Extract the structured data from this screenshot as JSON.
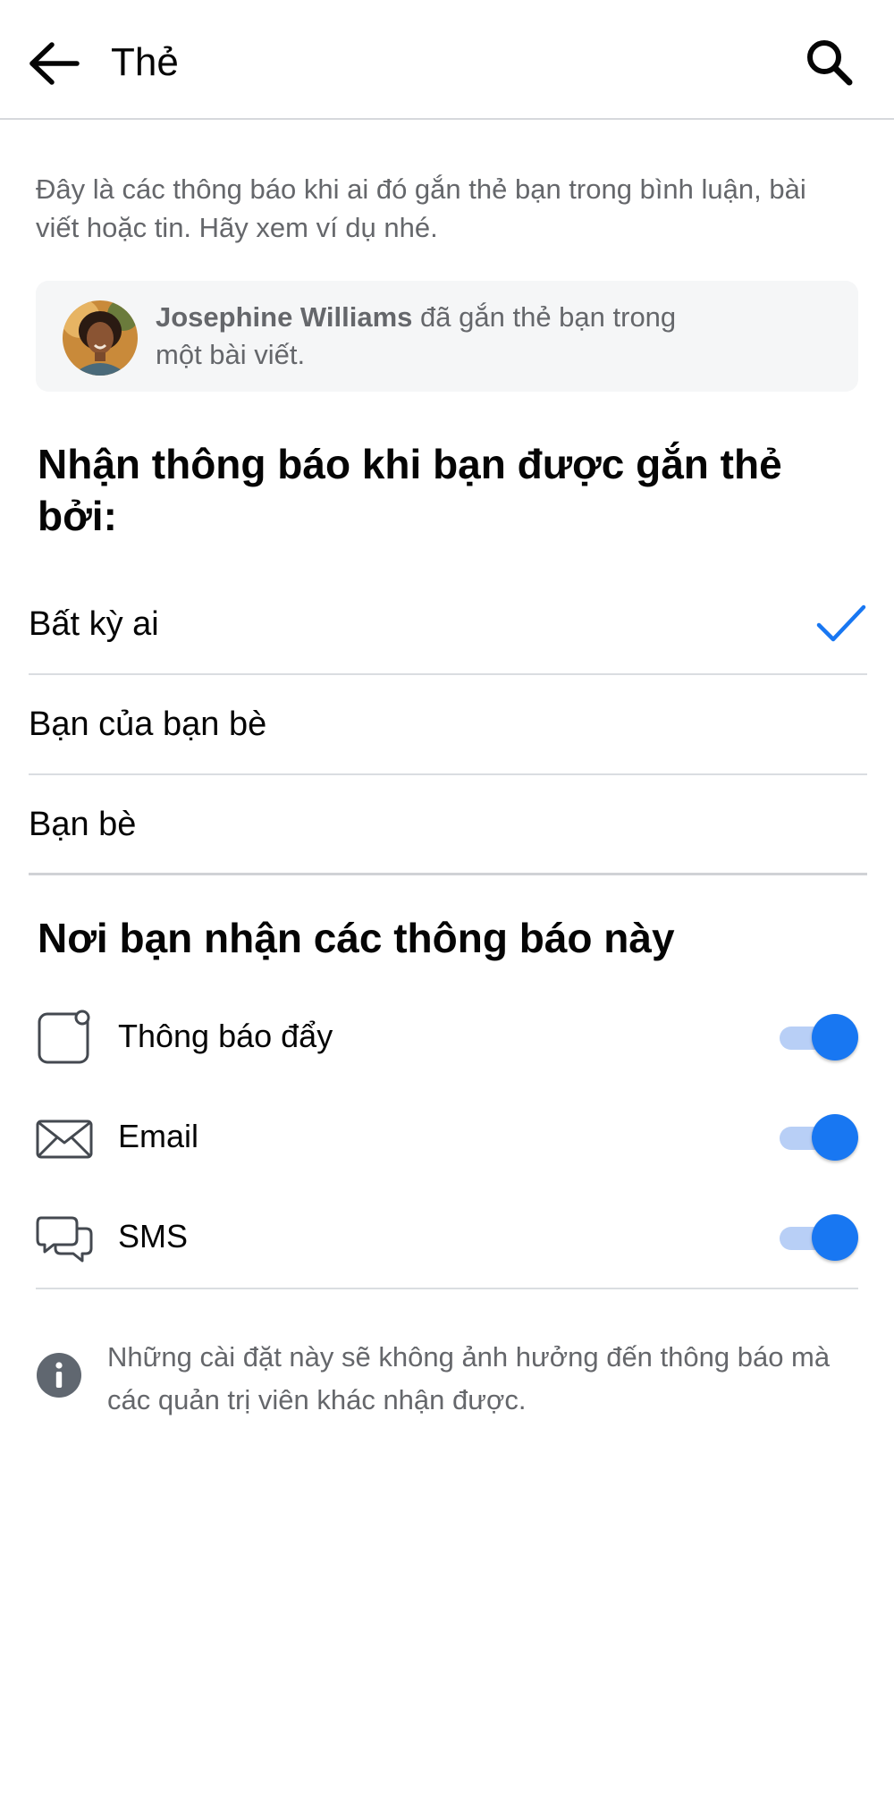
{
  "header": {
    "title": "Thẻ",
    "back_icon": "arrow-left-icon",
    "search_icon": "search-icon"
  },
  "intro": {
    "text": "Đây là các thông báo khi ai đó gắn thẻ bạn trong bình luận, bài viết hoặc tin. Hãy xem ví dụ nhé."
  },
  "example": {
    "name": "Josephine Williams",
    "message": " đã gắn thẻ bạn trong một bài viết."
  },
  "tag_section": {
    "heading": "Nhận thông báo khi bạn được gắn thẻ bởi:",
    "options": [
      {
        "label": "Bất kỳ ai",
        "selected": true
      },
      {
        "label": "Bạn của bạn bè",
        "selected": false
      },
      {
        "label": "Bạn bè",
        "selected": false
      }
    ]
  },
  "channels_section": {
    "heading": "Nơi bạn nhận các thông báo này",
    "channels": [
      {
        "label": "Thông báo đẩy",
        "icon": "push-notification-icon",
        "enabled": true
      },
      {
        "label": "Email",
        "icon": "envelope-icon",
        "enabled": true
      },
      {
        "label": "SMS",
        "icon": "chat-bubbles-icon",
        "enabled": true
      }
    ]
  },
  "footer": {
    "icon": "info-icon",
    "text": "Những cài đặt này sẽ không ảnh hưởng đến thông báo mà các quản trị viên khác nhận được."
  },
  "colors": {
    "accent": "#1877f2",
    "toggle_track": "#b8cff6",
    "secondary_text": "#65676b",
    "divider": "#dadde1"
  }
}
